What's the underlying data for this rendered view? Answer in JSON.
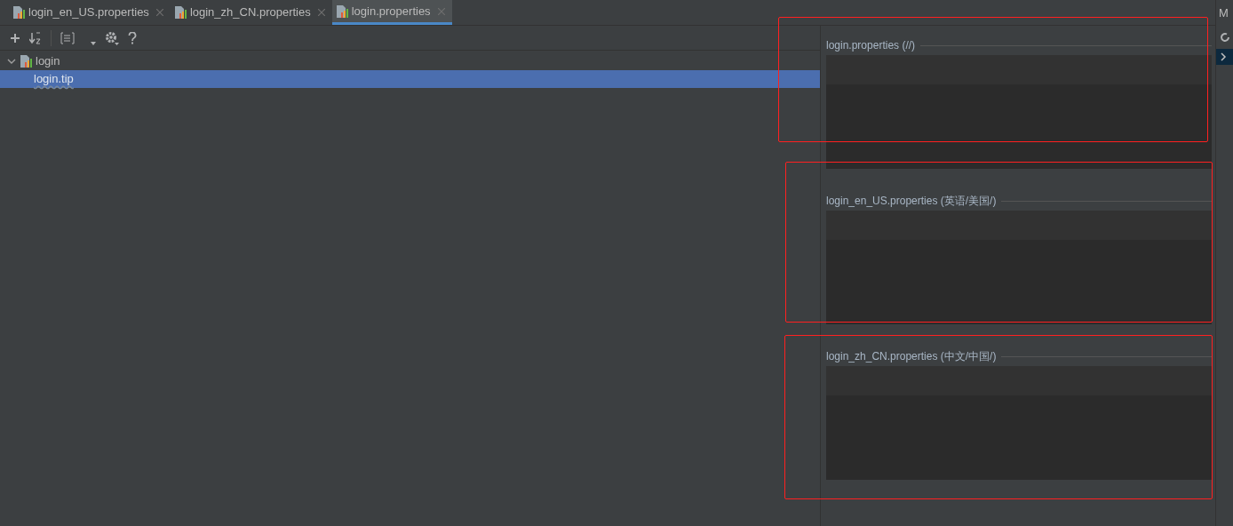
{
  "tabs": [
    {
      "label": "login_en_US.properties",
      "selected": false
    },
    {
      "label": "login_zh_CN.properties",
      "selected": false
    },
    {
      "label": "login.properties",
      "selected": true
    }
  ],
  "tree": [
    {
      "label": "login",
      "expanded": true,
      "children": [
        {
          "label": "login.tip",
          "selected": true
        }
      ]
    }
  ],
  "sections": [
    {
      "title": "login.properties (//)"
    },
    {
      "title": "login_en_US.properties (英语/美国/)"
    },
    {
      "title": "login_zh_CN.properties (中文/中国/)"
    }
  ],
  "right_strip": {
    "label": "M"
  }
}
